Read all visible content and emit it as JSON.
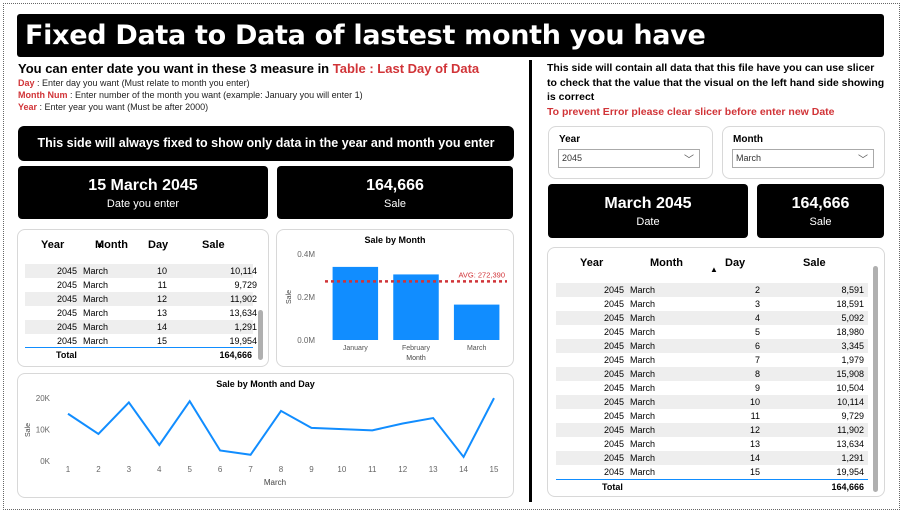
{
  "title": "Fixed Data to Data of lastest month you have",
  "intro": {
    "heading_prefix": "You can enter date you want in these 3 measure in ",
    "heading_table": "Table : Last Day of Data",
    "lines": [
      {
        "key": "Day",
        "text": " : Enter day you want (Must relate to month you enter)"
      },
      {
        "key": "Month Num",
        "text": " : Enter number of the month you want (example: January  you will enter 1)"
      },
      {
        "key": "Year",
        "text": " : Enter year you want (Must be after 2000)"
      }
    ]
  },
  "left_banner": "This side will always fixed to show only data in the year and month you enter",
  "left_cards": [
    {
      "value": "15 March 2045",
      "label": "Date you enter"
    },
    {
      "value": "164,666",
      "label": "Sale"
    }
  ],
  "left_table": {
    "headers": [
      "Year",
      "Month",
      "Day",
      "Sale"
    ],
    "rows": [
      [
        "2045",
        "March",
        "10",
        "10,114"
      ],
      [
        "2045",
        "March",
        "11",
        "9,729"
      ],
      [
        "2045",
        "March",
        "12",
        "11,902"
      ],
      [
        "2045",
        "March",
        "13",
        "13,634"
      ],
      [
        "2045",
        "March",
        "14",
        "1,291"
      ],
      [
        "2045",
        "March",
        "15",
        "19,954"
      ]
    ],
    "total_label": "Total",
    "total_value": "164,666"
  },
  "right_text": {
    "body": "This side will contain all data that this file have you can use slicer to check that the value that the visual on the left hand side showing is correct",
    "warning": "To prevent Error please clear slicer before enter new Date"
  },
  "slicers": [
    {
      "title": "Year",
      "value": "2045"
    },
    {
      "title": "Month",
      "value": "March"
    }
  ],
  "right_cards": [
    {
      "value": "March 2045",
      "label": "Date"
    },
    {
      "value": "164,666",
      "label": "Sale"
    }
  ],
  "right_table": {
    "headers": [
      "Year",
      "Month",
      "Day",
      "Sale"
    ],
    "rows": [
      [
        "2045",
        "March",
        "2",
        "8,591"
      ],
      [
        "2045",
        "March",
        "3",
        "18,591"
      ],
      [
        "2045",
        "March",
        "4",
        "5,092"
      ],
      [
        "2045",
        "March",
        "5",
        "18,980"
      ],
      [
        "2045",
        "March",
        "6",
        "3,345"
      ],
      [
        "2045",
        "March",
        "7",
        "1,979"
      ],
      [
        "2045",
        "March",
        "8",
        "15,908"
      ],
      [
        "2045",
        "March",
        "9",
        "10,504"
      ],
      [
        "2045",
        "March",
        "10",
        "10,114"
      ],
      [
        "2045",
        "March",
        "11",
        "9,729"
      ],
      [
        "2045",
        "March",
        "12",
        "11,902"
      ],
      [
        "2045",
        "March",
        "13",
        "13,634"
      ],
      [
        "2045",
        "March",
        "14",
        "1,291"
      ],
      [
        "2045",
        "March",
        "15",
        "19,954"
      ]
    ],
    "total_label": "Total",
    "total_value": "164,666"
  },
  "colors": {
    "accent_red": "#d13438",
    "bar_blue": "#118dff",
    "line_blue": "#118dff"
  },
  "chart_data": [
    {
      "type": "bar",
      "title": "Sale by Month",
      "xlabel": "Month",
      "ylabel": "Sale",
      "categories": [
        "January",
        "February",
        "March"
      ],
      "values": [
        340000,
        305000,
        164666
      ],
      "ylim": [
        0,
        400000
      ],
      "yticks": [
        "0.0M",
        "0.2M",
        "0.4M"
      ],
      "reference_line": {
        "label": "AVG: 272,390",
        "value": 272390
      }
    },
    {
      "type": "line",
      "title": "Sale by Month and Day",
      "xlabel": "March",
      "ylabel": "Sale",
      "x": [
        1,
        2,
        3,
        4,
        5,
        6,
        7,
        8,
        9,
        10,
        11,
        12,
        13,
        14,
        15
      ],
      "values": [
        15000,
        8591,
        18591,
        5092,
        18980,
        3345,
        1979,
        15908,
        10504,
        10114,
        9729,
        11902,
        13634,
        1291,
        19954
      ],
      "ylim": [
        0,
        20000
      ],
      "yticks": [
        "0K",
        "10K",
        "20K"
      ]
    }
  ]
}
